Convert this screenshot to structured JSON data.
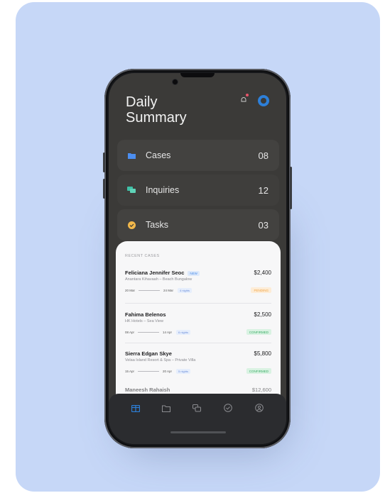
{
  "header": {
    "title": "Daily Summary",
    "title_line1": "Daily",
    "title_line2": "Summary"
  },
  "summary": [
    {
      "label": "Cases",
      "count": "08",
      "icon": "folder-icon",
      "color": "#4c8ef0"
    },
    {
      "label": "Inquiries",
      "count": "12",
      "icon": "chat-icon",
      "color": "#3fc0a6"
    },
    {
      "label": "Tasks",
      "count": "03",
      "icon": "check-circle-icon",
      "color": "#f2b84b"
    }
  ],
  "recent": {
    "heading": "RECENT CASES",
    "cases": [
      {
        "name": "Feliciana Jennifer Seoc",
        "badge": "NEW",
        "subtitle": "Anantara Kihavaah – Beach Bungalow",
        "amount": "$2,400",
        "start": "20 Mar",
        "end": "24 Mar",
        "nights": "4 nights",
        "status": "PENDING",
        "status_color": "#f0a64a",
        "status_bg": "#fdecd6"
      },
      {
        "name": "Fahima Belenos",
        "badge": "",
        "subtitle": "HK Hotels – Sea View",
        "amount": "$2,500",
        "start": "08 Apr",
        "end": "14 Apr",
        "nights": "6 nights",
        "status": "CONFIRMED",
        "status_color": "#3fae6a",
        "status_bg": "#d9f2e2"
      },
      {
        "name": "Sierra Edgan Skye",
        "badge": "",
        "subtitle": "Velaa Island Resort & Spa – Private Villa",
        "amount": "$5,800",
        "start": "15 Apr",
        "end": "20 Apr",
        "nights": "5 nights",
        "status": "CONFIRMED",
        "status_color": "#3fae6a",
        "status_bg": "#d9f2e2"
      }
    ],
    "partial_name": "Maneesh Rahaish",
    "partial_amount": "$12,600"
  },
  "nav": [
    {
      "name": "dashboard-icon",
      "active": true
    },
    {
      "name": "folder-icon",
      "active": false
    },
    {
      "name": "chat-icon",
      "active": false
    },
    {
      "name": "check-circle-icon",
      "active": false
    },
    {
      "name": "profile-icon",
      "active": false
    }
  ],
  "colors": {
    "accent": "#2d7fd8",
    "card_bg": "#c6d7f7",
    "screen_bg": "#3b3a38"
  }
}
